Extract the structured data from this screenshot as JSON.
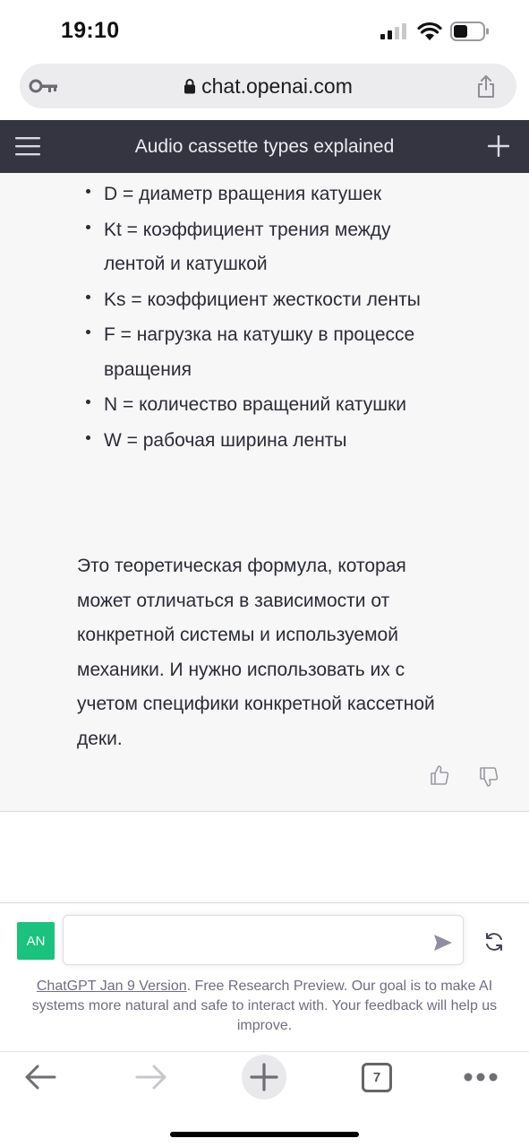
{
  "status_bar": {
    "time": "19:10",
    "icons": [
      "signal-icon",
      "wifi-icon",
      "battery-icon"
    ]
  },
  "url_bar": {
    "url": "chat.openai.com",
    "icons": [
      "key-icon",
      "lock-icon",
      "share-icon"
    ]
  },
  "header": {
    "title": "Audio cassette types explained",
    "icons": [
      "menu-icon",
      "plus-icon"
    ]
  },
  "message": {
    "bullets": [
      "D = диаметр вращения катушек",
      "Kt = коэффициент трения между лентой и катушкой",
      "Ks = коэффициент жесткости ленты",
      "F = нагрузка на катушку в процессе вращения",
      "N = количество вращений катушки",
      "W = рабочая ширина ленты"
    ],
    "paragraph": "Это теоретическая формула, которая может отличаться в зависимости от конкретной системы и используемой механики. И нужно использовать их с учетом специфики конкретной кассетной деки.",
    "icons": [
      "thumb-up-icon",
      "thumb-down-icon"
    ]
  },
  "composer": {
    "avatar_initials": "AN",
    "input_value": "",
    "icons": [
      "send-icon",
      "regenerate-icon"
    ],
    "footer_link": "ChatGPT Jan 9 Version",
    "footer_text": ". Free Research Preview. Our goal is to make AI systems more natural and safe to interact with. Your feedback will help us improve."
  },
  "toolbar": {
    "tab_count": "7",
    "icons": [
      "back-icon",
      "forward-icon",
      "new-tab-icon",
      "tabs-icon",
      "more-icon"
    ]
  },
  "colors": {
    "header_bg": "#343541",
    "message_bg": "#f7f7f8",
    "avatar_bg": "#19c37d",
    "url_bar_bg": "#ececee"
  }
}
